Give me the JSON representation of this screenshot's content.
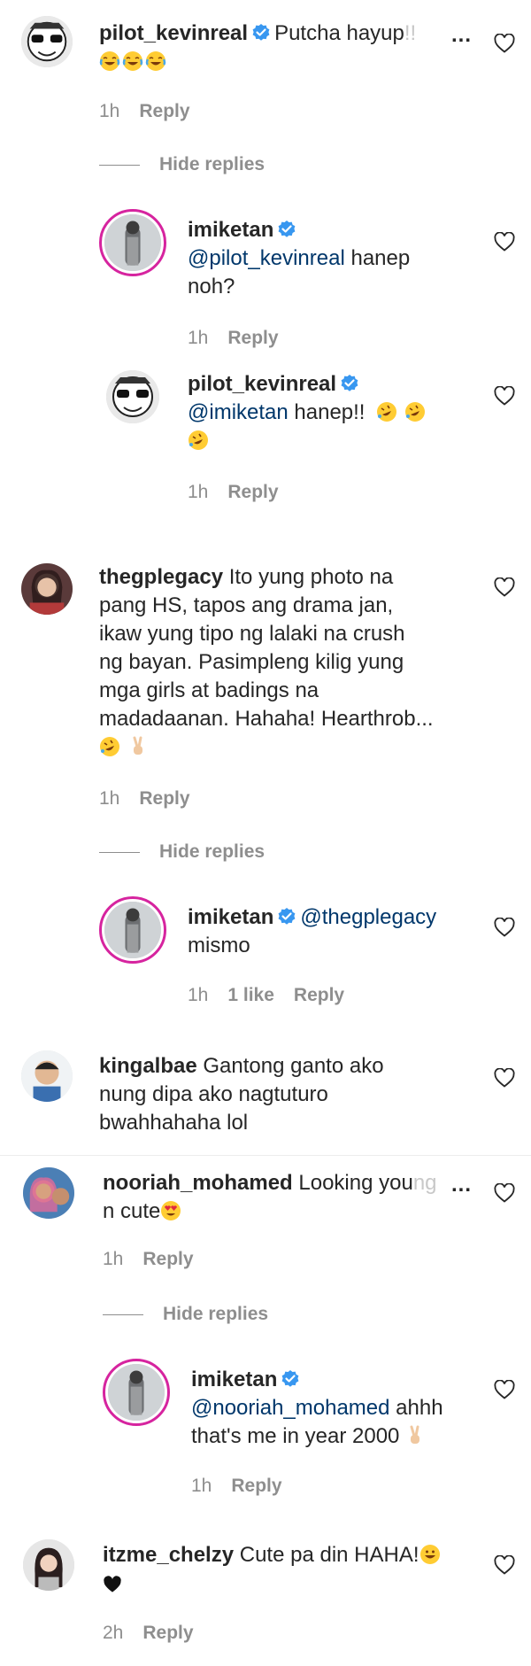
{
  "comments": {
    "c1": {
      "user": "pilot_kevinreal",
      "text_a": "Putcha hayup",
      "text_fade": "!!",
      "time": "1h",
      "reply": "Reply",
      "more": "..."
    },
    "hide1": "Hide replies",
    "r1": {
      "user": "imiketan",
      "mention": "@pilot_kevinreal",
      "text": " hanep",
      "text2": "noh?",
      "time": "1h",
      "reply": "Reply"
    },
    "r2": {
      "user": "pilot_kevinreal",
      "mention": "@imiketan",
      "text": " hanep!!",
      "time": "1h",
      "reply": "Reply"
    },
    "c2": {
      "user": "thegplegacy",
      "lines": [
        " Ito yung photo na",
        "pang HS, tapos ang drama jan,",
        "ikaw yung tipo ng lalaki na crush",
        "ng bayan. Pasimpleng kilig yung",
        "mga girls at badings na",
        "madadaanan. Hahaha! Hearthrob..."
      ],
      "time": "1h",
      "reply": "Reply"
    },
    "hide2": "Hide replies",
    "r3": {
      "user": "imiketan",
      "mention": "@thegplegacy",
      "text2": "mismo",
      "time": "1h",
      "likes": "1 like",
      "reply": "Reply"
    },
    "c3": {
      "user": "kingalbae",
      "lines": [
        " Gantong ganto ako",
        "nung dipa ako nagtuturo",
        "bwahhahaha lol"
      ]
    },
    "c4": {
      "user": "nooriah_mohamed",
      "text_a": " Looking you",
      "text_fade": "ng",
      "text2": "n cute",
      "time": "1h",
      "reply": "Reply",
      "more": "..."
    },
    "hide3": "Hide replies",
    "r4": {
      "user": "imiketan",
      "mention": "@nooriah_mohamed",
      "text": " ahhh",
      "text2": "that's me in year 2000",
      "time": "1h",
      "reply": "Reply"
    },
    "c5": {
      "user": "itzme_chelzy",
      "text": " Cute pa din HAHA!",
      "time": "2h",
      "reply": "Reply"
    }
  },
  "colors": {
    "verified": "#3897f0",
    "mention": "#00376b",
    "meta": "#8e8e8e",
    "ring": "#d6249f"
  },
  "icons": [
    "heart-outline-icon",
    "verified-badge-icon",
    "more-options-icon",
    "laughing-tears-emoji",
    "rofl-emoji",
    "victory-hand-emoji",
    "heart-eyes-emoji",
    "grinning-emoji",
    "black-heart-emoji"
  ]
}
